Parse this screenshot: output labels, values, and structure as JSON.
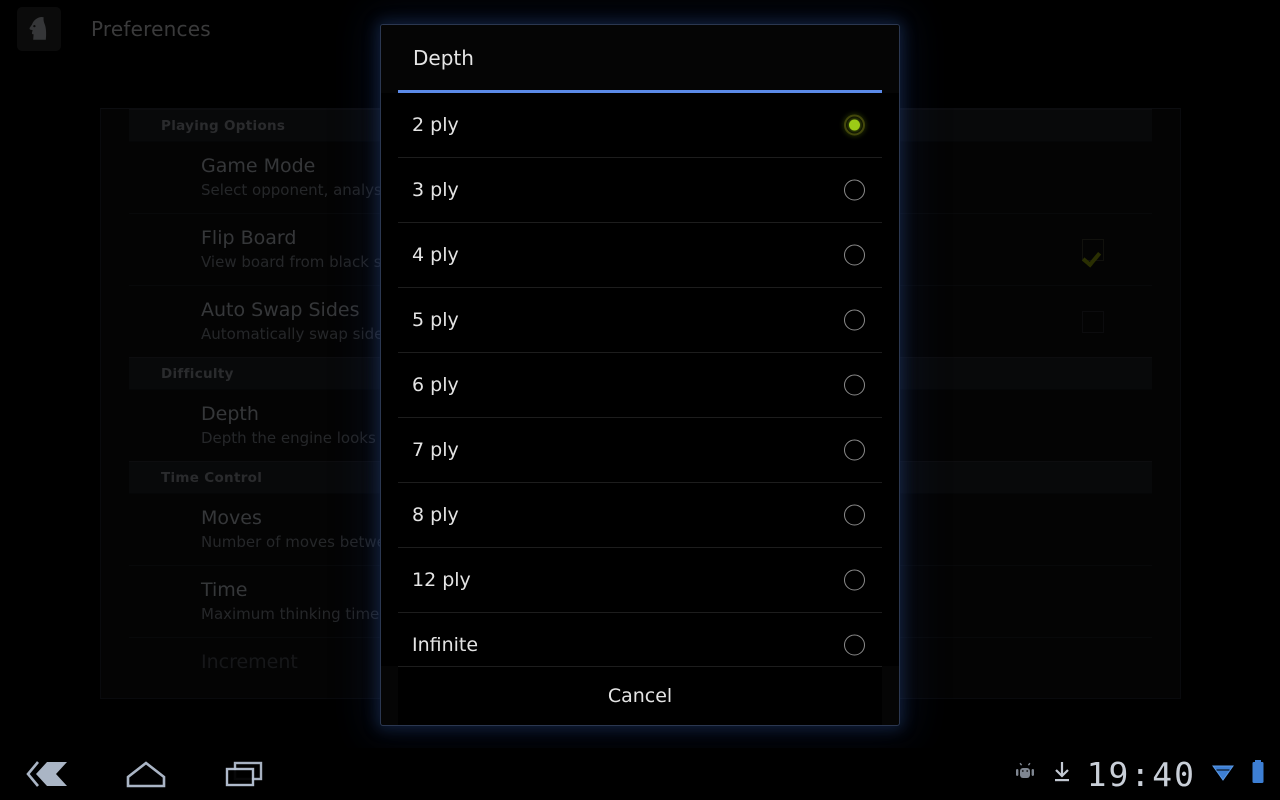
{
  "actionbar": {
    "app_icon": "chess-knight-icon",
    "title": "Preferences"
  },
  "preferences": {
    "sections": [
      {
        "header": "Playing Options",
        "rows": [
          {
            "title": "Game Mode",
            "summary": "Select opponent, analysis mode",
            "control": "none",
            "dim": false
          },
          {
            "title": "Flip Board",
            "summary": "View board from black side",
            "control": "checkbox-checked",
            "dim": false
          },
          {
            "title": "Auto Swap Sides",
            "summary": "Automatically swap sides when",
            "control": "checkbox-unchecked",
            "dim": false
          }
        ]
      },
      {
        "header": "Difficulty",
        "rows": [
          {
            "title": "Depth",
            "summary": "Depth the engine looks ahead",
            "control": "none",
            "dim": false
          }
        ]
      },
      {
        "header": "Time Control",
        "rows": [
          {
            "title": "Moves",
            "summary": "Number of moves between",
            "control": "none",
            "dim": false
          },
          {
            "title": "Time",
            "summary": "Maximum thinking time between",
            "control": "none",
            "dim": false
          },
          {
            "title": "Increment",
            "summary": "",
            "control": "none",
            "dim": true
          }
        ]
      }
    ]
  },
  "dialog": {
    "title": "Depth",
    "accent_color": "#5b8ae8",
    "selected_color": "#9ccb16",
    "selected_index": 0,
    "options": [
      {
        "label": "2 ply",
        "selected": true
      },
      {
        "label": "3 ply",
        "selected": false
      },
      {
        "label": "4 ply",
        "selected": false
      },
      {
        "label": "5 ply",
        "selected": false
      },
      {
        "label": "6 ply",
        "selected": false
      },
      {
        "label": "7 ply",
        "selected": false
      },
      {
        "label": "8 ply",
        "selected": false
      },
      {
        "label": "12 ply",
        "selected": false
      },
      {
        "label": "Infinite",
        "selected": false
      }
    ],
    "cancel_label": "Cancel"
  },
  "systembar": {
    "nav": [
      {
        "name": "back-icon"
      },
      {
        "name": "home-icon"
      },
      {
        "name": "recents-icon"
      }
    ],
    "status": [
      {
        "name": "android-bug-icon"
      },
      {
        "name": "download-icon"
      }
    ],
    "clock": "19:40",
    "indicators": [
      {
        "name": "wifi-icon"
      },
      {
        "name": "battery-icon"
      }
    ]
  }
}
